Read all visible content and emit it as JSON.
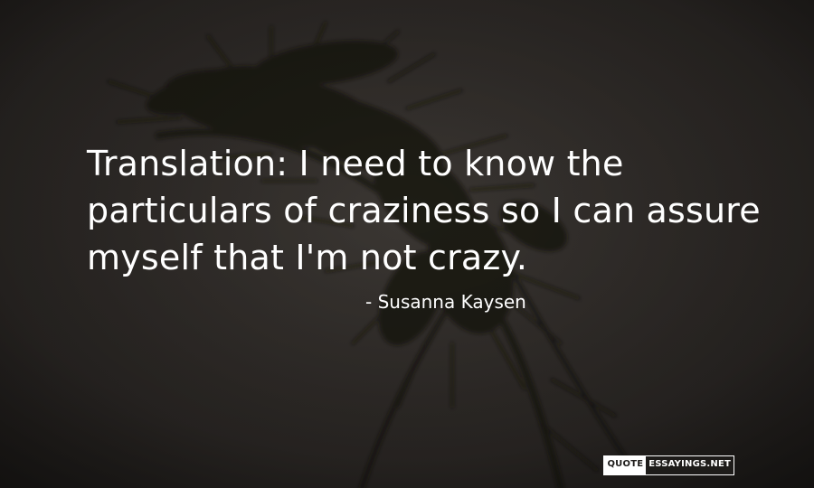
{
  "quote": {
    "lines": [
      "Translation: I need to know the",
      "particulars of craziness so I can assure",
      "myself that I'm not crazy."
    ],
    "author": "- Susanna Kaysen"
  },
  "watermark": {
    "part_a": "QUOTE",
    "part_b": "ESSAYINGS.NET"
  },
  "colors": {
    "background": "#2d2a27",
    "text": "#ffffff",
    "plant": "#15120f"
  }
}
